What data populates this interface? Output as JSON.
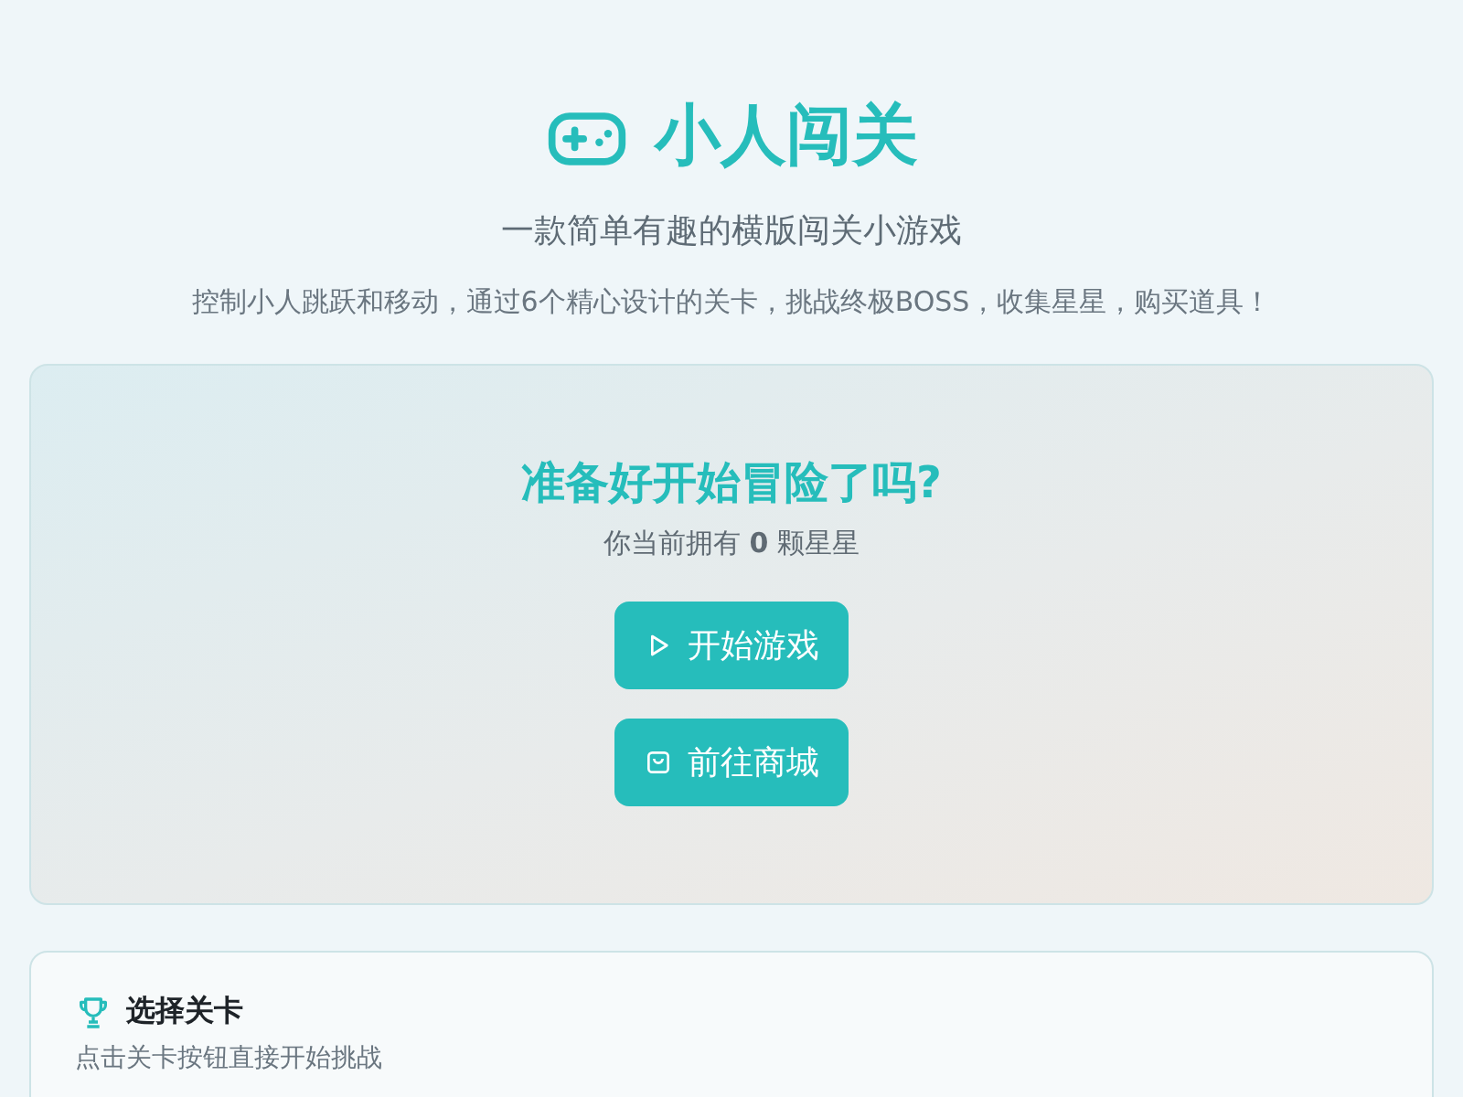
{
  "header": {
    "title": "小人闯关",
    "subtitle": "一款简单有趣的横版闯关小游戏",
    "description": "控制小人跳跃和移动，通过6个精心设计的关卡，挑战终极BOSS，收集星星，购买道具！"
  },
  "hero": {
    "heading": "准备好开始冒险了吗?",
    "stars_text": "你当前拥有 **0** 颗星星",
    "buttons": [
      {
        "label": "开始游戏",
        "kind": "play"
      },
      {
        "label": "前往商城",
        "kind": "bag"
      }
    ]
  },
  "levels": {
    "title": "选择关卡",
    "hint": "点击关卡按钮直接开始挑战"
  }
}
